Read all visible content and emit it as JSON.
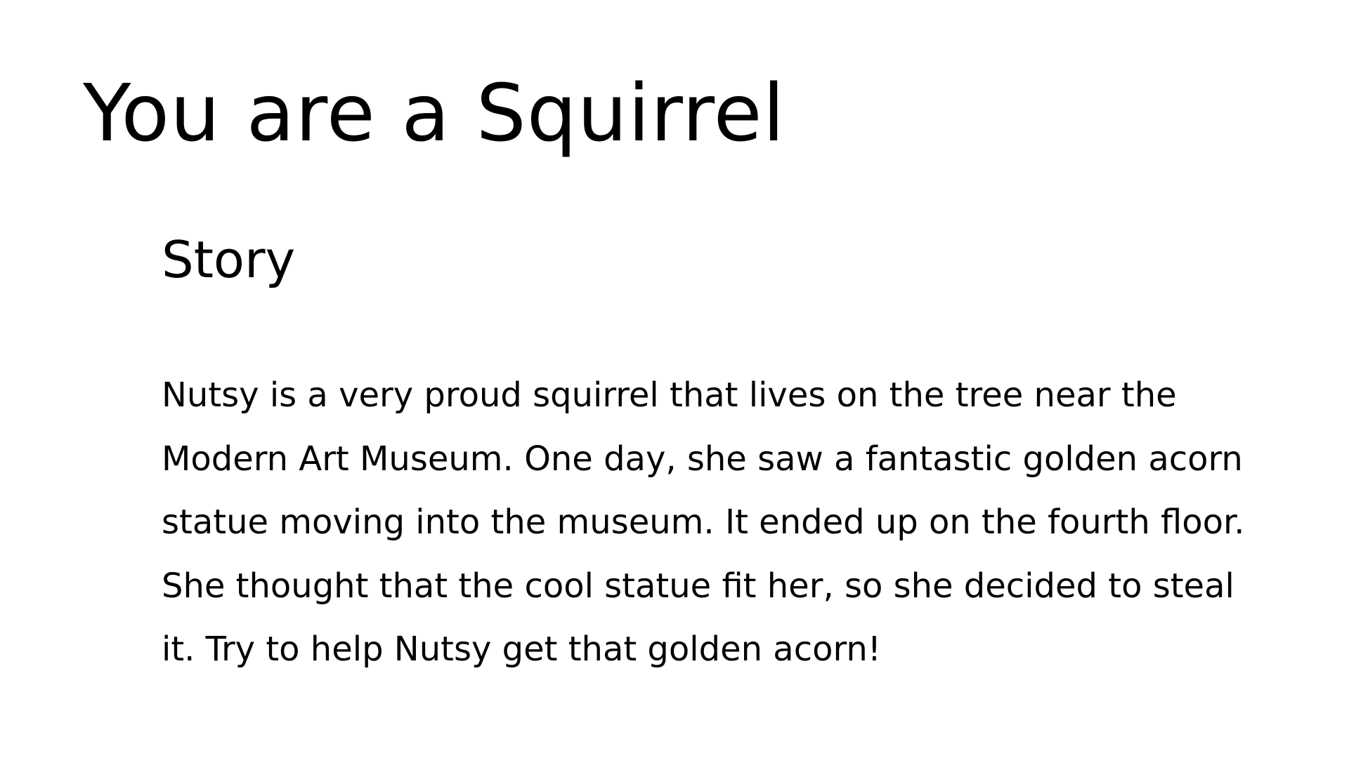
{
  "page": {
    "title": "You are a Squirrel"
  },
  "story": {
    "heading": "Story",
    "lines": [
      "Nutsy is a very proud squirrel that lives on the tree near the",
      "Modern Art Museum. One day, she saw a fantastic golden acorn",
      "statue moving into the museum. It ended up on the fourth floor.",
      "She thought that the cool statue fit her, so she decided to steal",
      "it. Try to help Nutsy get that golden acorn!"
    ]
  }
}
